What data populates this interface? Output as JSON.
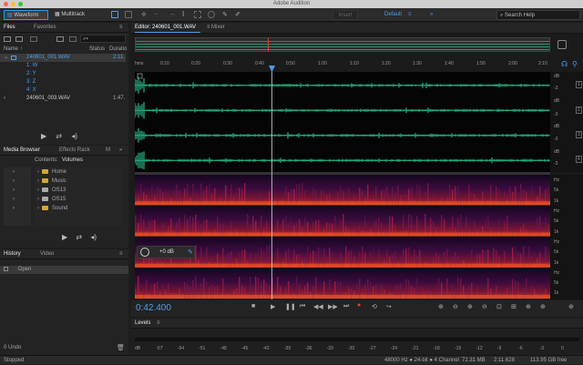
{
  "app": {
    "title": "Adobe Audition"
  },
  "toolbar": {
    "waveform_label": "Waveform",
    "multitrack_label": "Multitrack",
    "insert_label": "Insert",
    "workspace": "Default",
    "search_placeholder": "Search Help"
  },
  "files_panel": {
    "tabs": [
      "Files",
      "Favorites"
    ],
    "columns": {
      "name": "Name ↑",
      "status": "Status",
      "duration": "Duratio"
    },
    "rows": [
      {
        "name": "240601_001.WAV",
        "duration": "2:11.",
        "selected": true
      },
      {
        "name": "1: W",
        "duration": ""
      },
      {
        "name": "2: Y",
        "duration": ""
      },
      {
        "name": "3: Z",
        "duration": ""
      },
      {
        "name": "4: X",
        "duration": ""
      },
      {
        "name": "240601_003.WAV",
        "duration": "1:47."
      }
    ]
  },
  "media_browser": {
    "tabs": [
      "Media Browser",
      "Effects Rack",
      "M"
    ],
    "contents_label": "Contents:",
    "contents_value": "Volumes",
    "items": [
      "Home",
      "Music",
      "OS13",
      "OS15",
      "Sound"
    ]
  },
  "history": {
    "tabs": [
      "History",
      "Video"
    ],
    "items": [
      "Open"
    ],
    "undo_label": "0 Undo"
  },
  "editor": {
    "tab_label": "Editor: 240601_001.WAV",
    "mixer_label": "Mixer",
    "ruler": [
      "hms",
      "0:10",
      "0:20",
      "0:30",
      "0:40",
      "0:50",
      "1:00",
      "1:10",
      "1:20",
      "1:30",
      "1:40",
      "1:50",
      "2:00",
      "2:10"
    ],
    "playhead_fraction": 0.329,
    "db_labels": [
      "dB",
      "-3",
      "dB",
      "-3",
      "dB",
      "-3",
      "dB",
      "-3"
    ],
    "channel_numbers": [
      "1",
      "2",
      "3",
      "4"
    ],
    "hz_labels": [
      "Hz",
      "5k",
      "1k",
      "Hz",
      "5k",
      "1k",
      "Hz",
      "5k",
      "1k",
      "Hz",
      "5k",
      "1k"
    ],
    "hud_value": "+0 dB",
    "time_display": "0:42.400"
  },
  "levels": {
    "title": "Levels",
    "scale": [
      "dB",
      "-57",
      "-54",
      "-51",
      "-48",
      "-45",
      "-42",
      "-39",
      "-36",
      "-33",
      "-30",
      "-27",
      "-24",
      "-21",
      "-18",
      "-15",
      "-12",
      "-9",
      "-6",
      "-3",
      "0"
    ]
  },
  "status": {
    "left": "Stopped",
    "format": "48000 Hz ● 24-bit ● 4 Channel",
    "size": "72.31 MB",
    "duration": "2:11.628",
    "free": "113.95 GB free"
  },
  "colors": {
    "accent": "#4f9ded",
    "waveform": "#2ed89a",
    "spectral_hot": "#ff5a1e",
    "spectral_bg": "#2a0a3a"
  }
}
